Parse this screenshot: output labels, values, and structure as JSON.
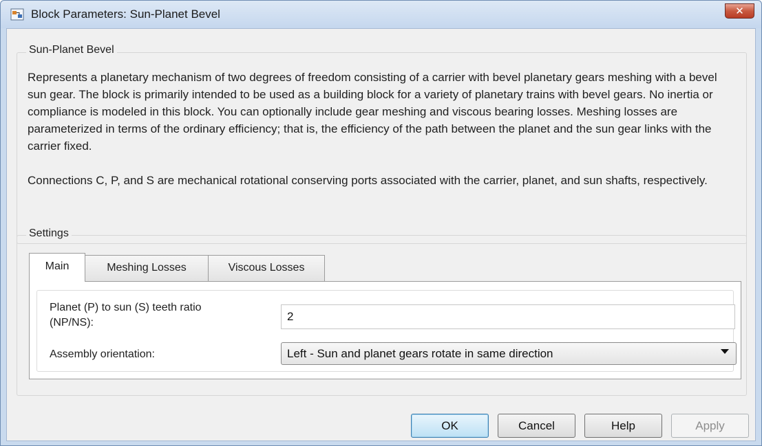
{
  "window": {
    "title": "Block Parameters: Sun-Planet Bevel",
    "close_glyph": "✕"
  },
  "description": {
    "group_title": "Sun-Planet Bevel",
    "paragraphs": [
      "Represents a planetary mechanism of two degrees of freedom consisting of a carrier with bevel planetary gears meshing with a bevel sun gear. The block is primarily intended to be used as a building block for a variety of planetary trains with bevel gears. No inertia or compliance is modeled in this block. You can optionally include gear meshing and viscous bearing losses. Meshing losses are parameterized in terms of the ordinary efficiency; that is, the efficiency of the path between the planet and the sun gear links with the carrier fixed.",
      "Connections C, P, and S are mechanical rotational conserving ports associated with the carrier, planet, and sun shafts, respectively."
    ]
  },
  "settings": {
    "group_title": "Settings",
    "tabs": [
      {
        "label": "Main",
        "active": true
      },
      {
        "label": "Meshing Losses",
        "active": false
      },
      {
        "label": "Viscous Losses",
        "active": false
      }
    ],
    "params": {
      "teeth_ratio_label_line1": "Planet (P) to sun (S) teeth ratio",
      "teeth_ratio_label_line2": "(NP/NS):",
      "teeth_ratio_value": "2",
      "orientation_label": "Assembly orientation:",
      "orientation_value": "Left - Sun and planet gears rotate in same direction"
    }
  },
  "buttons": {
    "ok": "OK",
    "cancel": "Cancel",
    "help": "Help",
    "apply": "Apply"
  },
  "icons": {
    "app": "simulink-block-icon",
    "close": "close-icon",
    "dropdown": "chevron-down-icon"
  }
}
